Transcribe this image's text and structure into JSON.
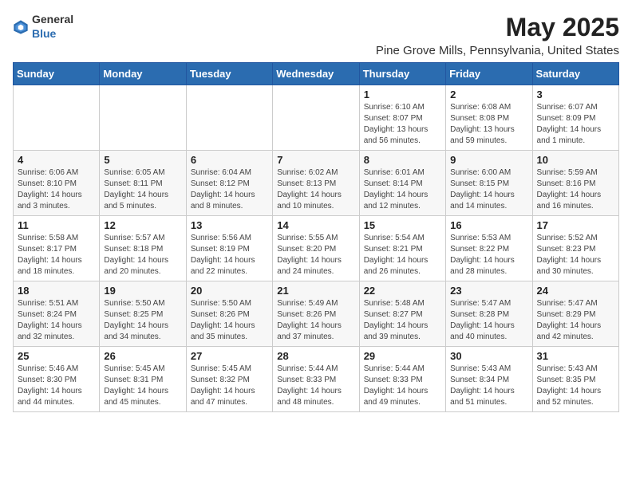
{
  "logo": {
    "text_general": "General",
    "text_blue": "Blue"
  },
  "title": "May 2025",
  "subtitle": "Pine Grove Mills, Pennsylvania, United States",
  "days_of_week": [
    "Sunday",
    "Monday",
    "Tuesday",
    "Wednesday",
    "Thursday",
    "Friday",
    "Saturday"
  ],
  "weeks": [
    [
      {
        "day": "",
        "info": ""
      },
      {
        "day": "",
        "info": ""
      },
      {
        "day": "",
        "info": ""
      },
      {
        "day": "",
        "info": ""
      },
      {
        "day": "1",
        "info": "Sunrise: 6:10 AM\nSunset: 8:07 PM\nDaylight: 13 hours and 56 minutes."
      },
      {
        "day": "2",
        "info": "Sunrise: 6:08 AM\nSunset: 8:08 PM\nDaylight: 13 hours and 59 minutes."
      },
      {
        "day": "3",
        "info": "Sunrise: 6:07 AM\nSunset: 8:09 PM\nDaylight: 14 hours and 1 minute."
      }
    ],
    [
      {
        "day": "4",
        "info": "Sunrise: 6:06 AM\nSunset: 8:10 PM\nDaylight: 14 hours and 3 minutes."
      },
      {
        "day": "5",
        "info": "Sunrise: 6:05 AM\nSunset: 8:11 PM\nDaylight: 14 hours and 5 minutes."
      },
      {
        "day": "6",
        "info": "Sunrise: 6:04 AM\nSunset: 8:12 PM\nDaylight: 14 hours and 8 minutes."
      },
      {
        "day": "7",
        "info": "Sunrise: 6:02 AM\nSunset: 8:13 PM\nDaylight: 14 hours and 10 minutes."
      },
      {
        "day": "8",
        "info": "Sunrise: 6:01 AM\nSunset: 8:14 PM\nDaylight: 14 hours and 12 minutes."
      },
      {
        "day": "9",
        "info": "Sunrise: 6:00 AM\nSunset: 8:15 PM\nDaylight: 14 hours and 14 minutes."
      },
      {
        "day": "10",
        "info": "Sunrise: 5:59 AM\nSunset: 8:16 PM\nDaylight: 14 hours and 16 minutes."
      }
    ],
    [
      {
        "day": "11",
        "info": "Sunrise: 5:58 AM\nSunset: 8:17 PM\nDaylight: 14 hours and 18 minutes."
      },
      {
        "day": "12",
        "info": "Sunrise: 5:57 AM\nSunset: 8:18 PM\nDaylight: 14 hours and 20 minutes."
      },
      {
        "day": "13",
        "info": "Sunrise: 5:56 AM\nSunset: 8:19 PM\nDaylight: 14 hours and 22 minutes."
      },
      {
        "day": "14",
        "info": "Sunrise: 5:55 AM\nSunset: 8:20 PM\nDaylight: 14 hours and 24 minutes."
      },
      {
        "day": "15",
        "info": "Sunrise: 5:54 AM\nSunset: 8:21 PM\nDaylight: 14 hours and 26 minutes."
      },
      {
        "day": "16",
        "info": "Sunrise: 5:53 AM\nSunset: 8:22 PM\nDaylight: 14 hours and 28 minutes."
      },
      {
        "day": "17",
        "info": "Sunrise: 5:52 AM\nSunset: 8:23 PM\nDaylight: 14 hours and 30 minutes."
      }
    ],
    [
      {
        "day": "18",
        "info": "Sunrise: 5:51 AM\nSunset: 8:24 PM\nDaylight: 14 hours and 32 minutes."
      },
      {
        "day": "19",
        "info": "Sunrise: 5:50 AM\nSunset: 8:25 PM\nDaylight: 14 hours and 34 minutes."
      },
      {
        "day": "20",
        "info": "Sunrise: 5:50 AM\nSunset: 8:26 PM\nDaylight: 14 hours and 35 minutes."
      },
      {
        "day": "21",
        "info": "Sunrise: 5:49 AM\nSunset: 8:26 PM\nDaylight: 14 hours and 37 minutes."
      },
      {
        "day": "22",
        "info": "Sunrise: 5:48 AM\nSunset: 8:27 PM\nDaylight: 14 hours and 39 minutes."
      },
      {
        "day": "23",
        "info": "Sunrise: 5:47 AM\nSunset: 8:28 PM\nDaylight: 14 hours and 40 minutes."
      },
      {
        "day": "24",
        "info": "Sunrise: 5:47 AM\nSunset: 8:29 PM\nDaylight: 14 hours and 42 minutes."
      }
    ],
    [
      {
        "day": "25",
        "info": "Sunrise: 5:46 AM\nSunset: 8:30 PM\nDaylight: 14 hours and 44 minutes."
      },
      {
        "day": "26",
        "info": "Sunrise: 5:45 AM\nSunset: 8:31 PM\nDaylight: 14 hours and 45 minutes."
      },
      {
        "day": "27",
        "info": "Sunrise: 5:45 AM\nSunset: 8:32 PM\nDaylight: 14 hours and 47 minutes."
      },
      {
        "day": "28",
        "info": "Sunrise: 5:44 AM\nSunset: 8:33 PM\nDaylight: 14 hours and 48 minutes."
      },
      {
        "day": "29",
        "info": "Sunrise: 5:44 AM\nSunset: 8:33 PM\nDaylight: 14 hours and 49 minutes."
      },
      {
        "day": "30",
        "info": "Sunrise: 5:43 AM\nSunset: 8:34 PM\nDaylight: 14 hours and 51 minutes."
      },
      {
        "day": "31",
        "info": "Sunrise: 5:43 AM\nSunset: 8:35 PM\nDaylight: 14 hours and 52 minutes."
      }
    ]
  ]
}
